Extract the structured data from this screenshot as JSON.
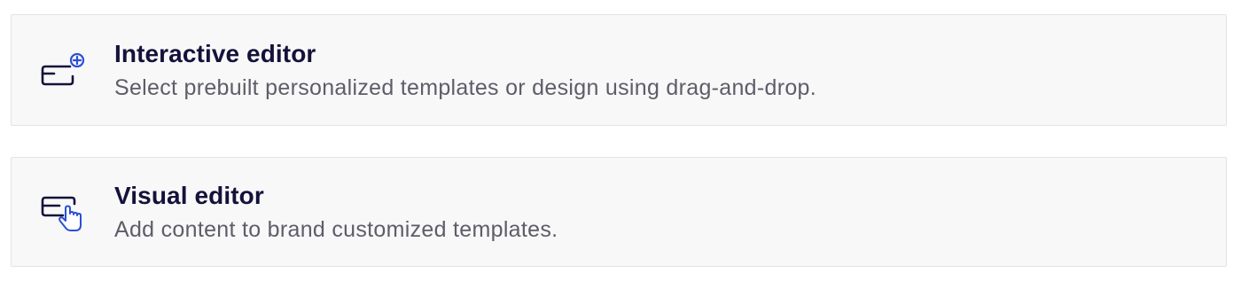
{
  "options": [
    {
      "title": "Interactive editor",
      "description": "Select prebuilt personalized templates or design using drag-and-drop.",
      "icon": "editor-add-icon"
    },
    {
      "title": "Visual editor",
      "description": "Add content to brand customized templates.",
      "icon": "editor-pointer-icon"
    }
  ],
  "colors": {
    "title": "#14123a",
    "description": "#5e5d68",
    "accent": "#2b4fd6",
    "card_background": "#f8f8f9",
    "card_border": "#e3e3e6"
  }
}
